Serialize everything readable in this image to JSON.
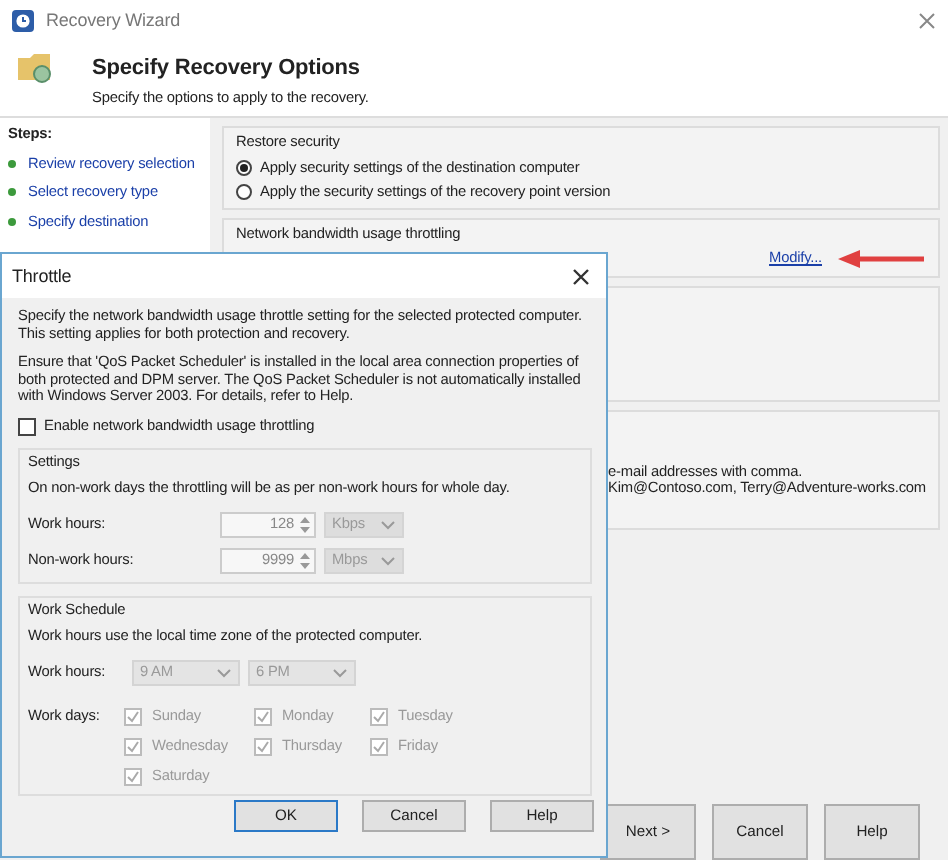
{
  "window": {
    "title": "Recovery Wizard"
  },
  "header": {
    "title": "Specify Recovery Options",
    "subtitle": "Specify the options to apply to the recovery."
  },
  "steps": {
    "heading": "Steps:",
    "items": [
      {
        "label": "Review recovery selection"
      },
      {
        "label": "Select recovery type"
      },
      {
        "label": "Specify destination"
      }
    ]
  },
  "restore_security": {
    "label": "Restore security",
    "options": [
      {
        "label": "Apply security settings of the destination computer",
        "selected": true
      },
      {
        "label": "Apply the security settings of the recovery point version",
        "selected": false
      }
    ]
  },
  "throttling": {
    "label": "Network bandwidth usage throttling",
    "link": "Modify..."
  },
  "notification": {
    "hint": "e-mail addresses with comma.",
    "value": "Kim@Contoso.com, Terry@Adventure-works.com"
  },
  "buttons": [
    "Next >",
    "Cancel",
    "Help"
  ],
  "dialog": {
    "title": "Throttle",
    "paragraphs": [
      "Specify the network bandwidth usage throttle setting for the selected protected computer. This setting applies for both protection and recovery.",
      "Ensure that 'QoS Packet Scheduler' is installed in the local area connection properties of both protected and DPM server. The QoS Packet Scheduler is not automatically installed with Windows Server 2003. For details, refer to Help."
    ],
    "enable": {
      "label": "Enable network bandwidth usage throttling",
      "checked": false
    },
    "settings": {
      "label": "Settings",
      "note": "On non-work days the throttling will be as per non-work hours for whole day.",
      "rows": [
        {
          "label": "Work hours:",
          "value": "128",
          "unit": "Kbps"
        },
        {
          "label": "Non-work hours:",
          "value": "9999",
          "unit": "Mbps"
        }
      ]
    },
    "schedule": {
      "label": "Work Schedule",
      "note": "Work hours use the local time zone of the protected computer.",
      "hours_label": "Work hours:",
      "start": "9 AM",
      "end": "6 PM",
      "days_label": "Work days:",
      "days": [
        {
          "label": "Sunday",
          "checked": true
        },
        {
          "label": "Monday",
          "checked": true
        },
        {
          "label": "Tuesday",
          "checked": true
        },
        {
          "label": "Wednesday",
          "checked": true
        },
        {
          "label": "Thursday",
          "checked": true
        },
        {
          "label": "Friday",
          "checked": true
        },
        {
          "label": "Saturday",
          "checked": true
        }
      ]
    },
    "buttons": [
      {
        "label": "OK",
        "default": true
      },
      {
        "label": "Cancel",
        "default": false
      },
      {
        "label": "Help",
        "default": false
      }
    ]
  }
}
